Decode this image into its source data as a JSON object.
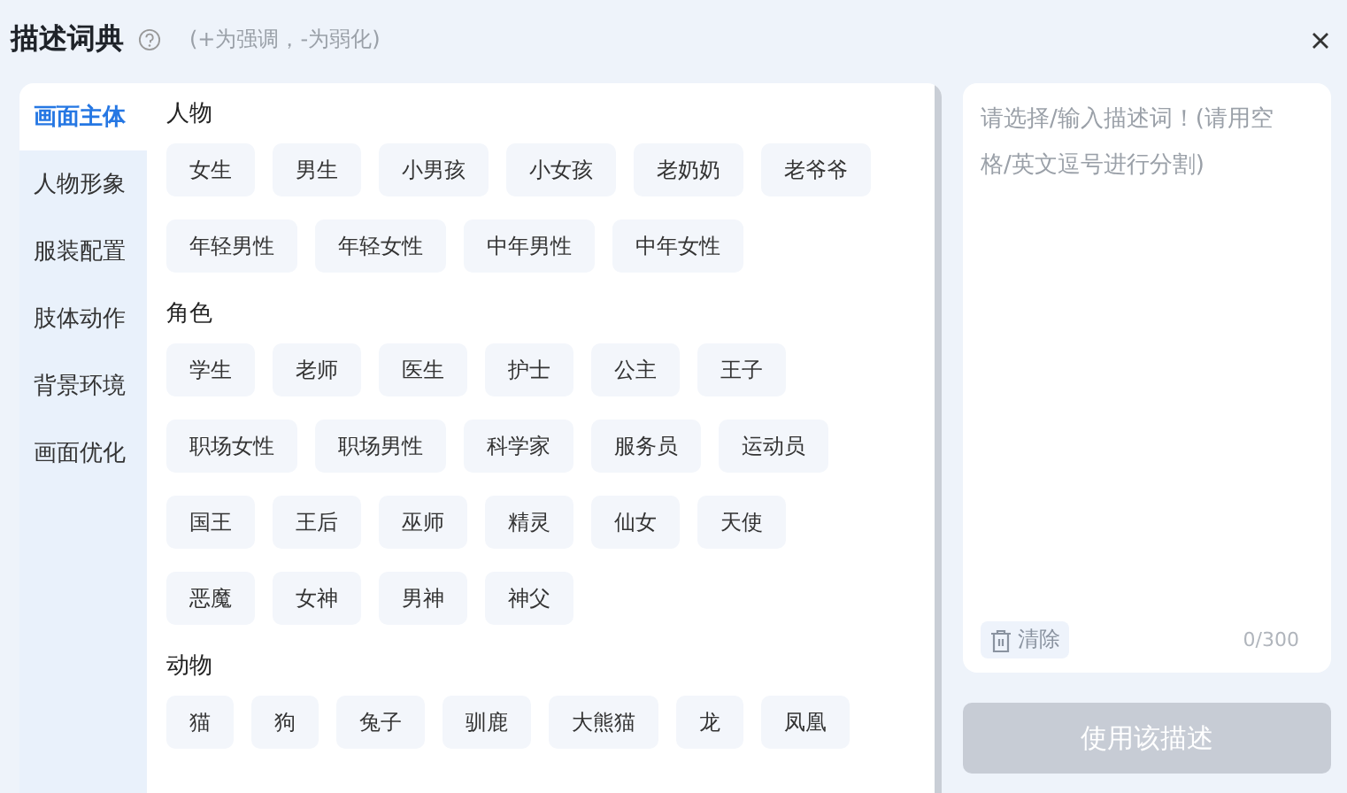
{
  "title": "描述词典",
  "hint": "(+为强调，-为弱化)",
  "tabs": [
    {
      "label": "画面主体",
      "selected": true
    },
    {
      "label": "人物形象",
      "selected": false
    },
    {
      "label": "服装配置",
      "selected": false
    },
    {
      "label": "肢体动作",
      "selected": false
    },
    {
      "label": "背景环境",
      "selected": false
    },
    {
      "label": "画面优化",
      "selected": false
    }
  ],
  "sections": [
    {
      "title": "人物",
      "tags": [
        "女生",
        "男生",
        "小男孩",
        "小女孩",
        "老奶奶",
        "老爷爷",
        "年轻男性",
        "年轻女性",
        "中年男性",
        "中年女性"
      ]
    },
    {
      "title": "角色",
      "tags": [
        "学生",
        "老师",
        "医生",
        "护士",
        "公主",
        "王子",
        "职场女性",
        "职场男性",
        "科学家",
        "服务员",
        "运动员",
        "国王",
        "王后",
        "巫师",
        "精灵",
        "仙女",
        "天使",
        "恶魔",
        "女神",
        "男神",
        "神父"
      ]
    },
    {
      "title": "动物",
      "tags": [
        "猫",
        "狗",
        "兔子",
        "驯鹿",
        "大熊猫",
        "龙",
        "凤凰"
      ]
    }
  ],
  "editor": {
    "placeholder": "请选择/输入描述词！(请用空格/英文逗号进行分割)",
    "clear": "清除",
    "count": "0/300"
  },
  "submit": {
    "label": "使用该描述",
    "disabled": true
  }
}
